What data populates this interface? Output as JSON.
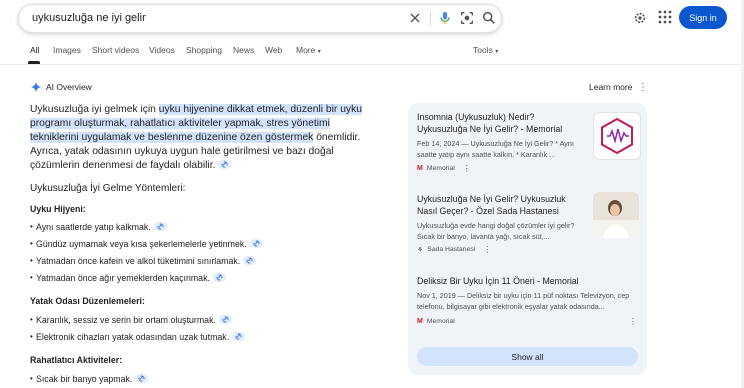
{
  "search": {
    "query": "uykusuzluğa ne iyi gelir"
  },
  "header": {
    "signin_label": "Sign in"
  },
  "tabs": [
    {
      "label": "All",
      "active": true
    },
    {
      "label": "Images"
    },
    {
      "label": "Short videos"
    },
    {
      "label": "Videos"
    },
    {
      "label": "Shopping"
    },
    {
      "label": "News"
    },
    {
      "label": "Web"
    },
    {
      "label": "More"
    }
  ],
  "tools_label": "Tools",
  "ai_overview": {
    "title": "AI Overview",
    "learn_more": "Learn more",
    "intro": {
      "lead": "Uykusuzluğa iyi gelmek için ",
      "highlight": "uyku hijyenine dikkat etmek, düzenli bir uyku programı oluşturmak, rahatlatıcı aktiviteler yapmak, stres yönetimi tekniklerini uygulamak ve beslenme düzenine özen göstermek",
      "tail": " önemlidir. Ayrıca, yatak odasının uykuya uygun hale getirilmesi ve bazı doğal çözümlerin denenmesi de faydalı olabilir."
    },
    "section_title": "Uykusuzluğa İyi Gelme Yöntemleri:",
    "groups": [
      {
        "heading": "Uyku Hijyeni:",
        "items": [
          "Aynı saatlerde yatıp kalkmak.",
          "Gündüz uymamak veya kısa şekerlemelerle yetinmek.",
          "Yatmadan önce kafein ve alkol tüketimini sınırlamak.",
          "Yatmadan önce ağır yemeklerden kaçınmak."
        ]
      },
      {
        "heading": "Yatak Odası Düzenlemeleri:",
        "items": [
          "Karanlık, sessiz ve serin bir ortam oluşturmak.",
          "Elektronik cihazları yatak odasından uzak tutmak."
        ]
      },
      {
        "heading": "Rahatlatıcı Aktiviteler:",
        "items": [
          "Sıcak bir banyo yapmak."
        ]
      }
    ]
  },
  "sources": [
    {
      "title": "Insomnia (Uykusuzluk) Nedir? Uykusuzluğa Ne İyi Gelir? - Memorial",
      "snippet": "Feb 14, 2024 — Uykusuzluğa Ne İyi Gelir? * Aynı saatte yatıp aynı saatte kalkın. * Karanlık ...",
      "site": "Memorial"
    },
    {
      "title": "Uykusuzluğa Ne İyi Gelir? Uykusuzluk Nasıl Geçer? - Özel Sada Hastanesi",
      "snippet": "Uykusuzluğa evde hangi doğal çözümler iyi gelir? Sıcak bir banyo, lavanta yağı, sıcak süt,...",
      "site": "Sada Hastanesi"
    },
    {
      "title": "Deliksiz Bir Uyku İçin 11 Öneri - Memorial",
      "snippet": "Nov 1, 2019 — Deliksiz bir uyku için 11 püf noktası Televizyon, cep telefonu, bilgisayar gibi elektronik eşyalar yatak odasında...",
      "site": "Memorial"
    }
  ],
  "show_all_label": "Show all",
  "colors": {
    "accent": "#0b57d0",
    "highlight": "#d3e3fd",
    "panel": "#f0f4f9",
    "memorial": "#c5221f"
  }
}
